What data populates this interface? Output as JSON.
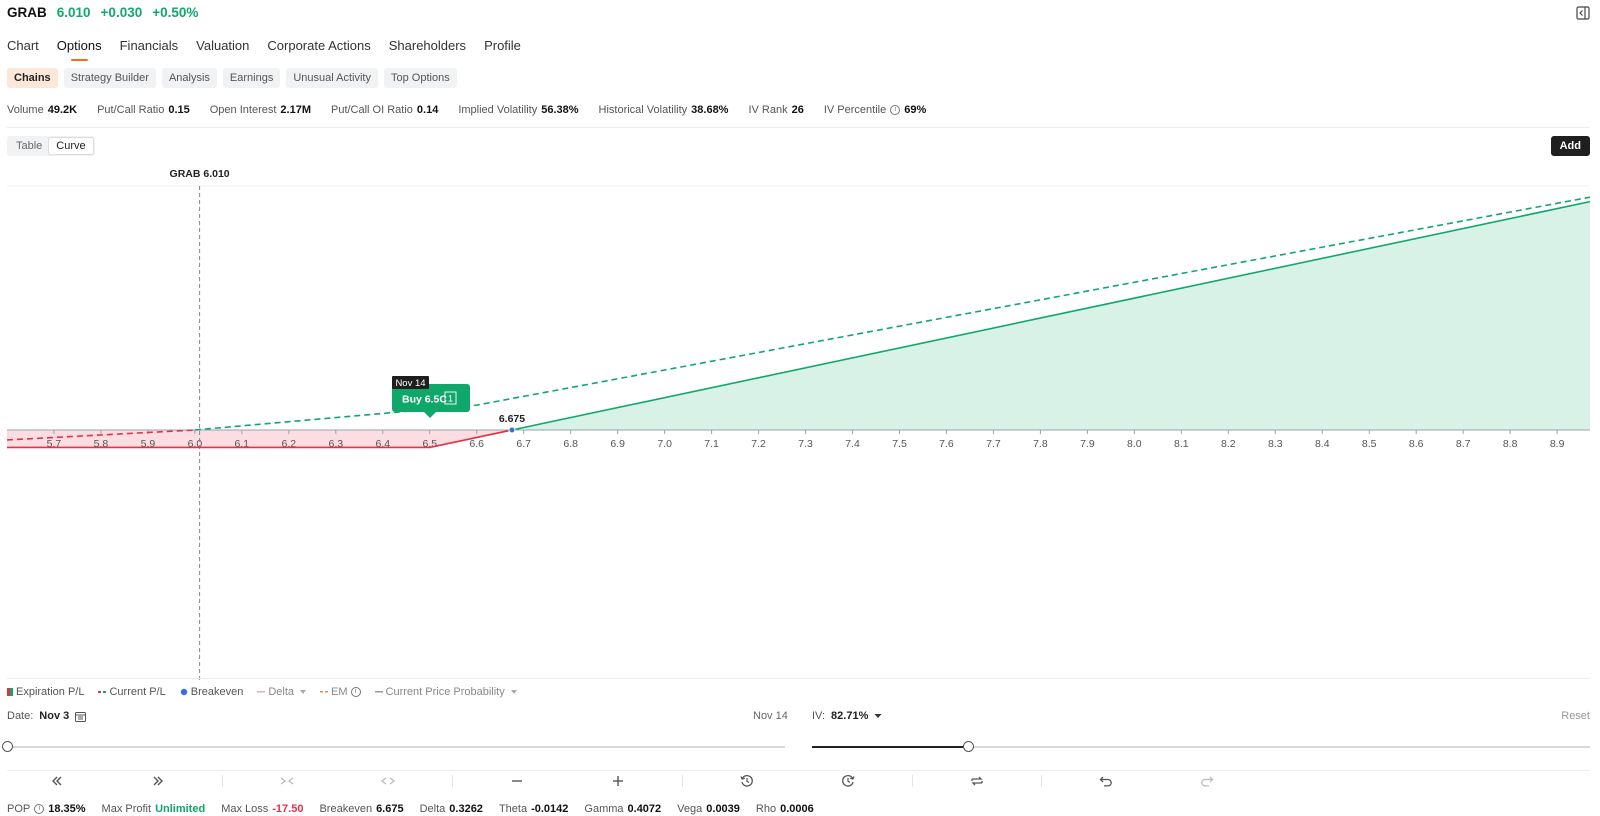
{
  "header": {
    "ticker": "GRAB",
    "price": "6.010",
    "change": "+0.030",
    "change_pct": "+0.50%"
  },
  "main_nav": [
    "Chart",
    "Options",
    "Financials",
    "Valuation",
    "Corporate Actions",
    "Shareholders",
    "Profile"
  ],
  "sub_nav": [
    "Chains",
    "Strategy Builder",
    "Analysis",
    "Earnings",
    "Unusual Activity",
    "Top Options"
  ],
  "stats": [
    {
      "label": "Volume",
      "value": "49.2K"
    },
    {
      "label": "Put/Call Ratio",
      "value": "0.15"
    },
    {
      "label": "Open Interest",
      "value": "2.17M"
    },
    {
      "label": "Put/Call OI Ratio",
      "value": "0.14"
    },
    {
      "label": "Implied Volatility",
      "value": "56.38%"
    },
    {
      "label": "Historical Volatility",
      "value": "38.68%"
    },
    {
      "label": "IV Rank",
      "value": "26"
    },
    {
      "label": "IV Percentile",
      "value": "69%"
    }
  ],
  "view_toggle": [
    "Table",
    "Curve"
  ],
  "add_label": "Add",
  "colors": {
    "profit": "#10a86a",
    "loss": "#e0334a",
    "breakeven": "#3a6de0",
    "accent": "#ff6a1a"
  },
  "chart_data": {
    "type": "line",
    "price_marker": {
      "label": "GRAB 6.010",
      "x": 6.01
    },
    "breakeven": {
      "label": "6.675",
      "x": 6.675
    },
    "tooltip": {
      "date": "Nov 14",
      "label": "Buy 6.5C",
      "qty": "1"
    },
    "x_ticks": [
      "5.7",
      "5.8",
      "5.9",
      "6.0",
      "6.1",
      "6.2",
      "6.3",
      "6.4",
      "6.5",
      "6.6",
      "6.7",
      "6.8",
      "6.9",
      "7.0",
      "7.1",
      "7.2",
      "7.3",
      "7.4",
      "7.5",
      "7.6",
      "7.7",
      "7.8",
      "7.9",
      "8.0",
      "8.1",
      "8.2",
      "8.3",
      "8.4",
      "8.5",
      "8.6",
      "8.7",
      "8.8",
      "8.9"
    ],
    "xlim": [
      5.6,
      8.97
    ],
    "series": [
      {
        "name": "Expiration P/L",
        "x": [
          5.6,
          6.5,
          6.675,
          8.97
        ],
        "y": [
          -17.5,
          -17.5,
          0,
          229.5
        ]
      },
      {
        "name": "Current P/L",
        "x": [
          5.6,
          6.0,
          6.6,
          8.97
        ],
        "y": [
          -10.0,
          0,
          25.0,
          234.0
        ]
      }
    ]
  },
  "legend": [
    {
      "label": "Expiration P/L",
      "on": true
    },
    {
      "label": "Current P/L",
      "on": true
    },
    {
      "label": "Breakeven",
      "on": true
    },
    {
      "label": "Delta",
      "on": false
    },
    {
      "label": "EM",
      "on": false
    },
    {
      "label": "Current Price Probability",
      "on": false
    }
  ],
  "date": {
    "label": "Date:",
    "value": "Nov 3",
    "expiry": "Nov 14",
    "position": 0
  },
  "iv": {
    "label": "IV:",
    "value": "82.71%",
    "reset": "Reset",
    "position": 0.2
  },
  "footer": [
    {
      "label": "POP",
      "value": "18.35%",
      "info": true,
      "cls": ""
    },
    {
      "label": "Max Profit",
      "value": "Unlimited",
      "cls": "green"
    },
    {
      "label": "Max Loss",
      "value": "-17.50",
      "cls": "red"
    },
    {
      "label": "Breakeven",
      "value": "6.675",
      "cls": ""
    },
    {
      "label": "Delta",
      "value": "0.3262",
      "cls": ""
    },
    {
      "label": "Theta",
      "value": "-0.0142",
      "cls": ""
    },
    {
      "label": "Gamma",
      "value": "0.4072",
      "cls": ""
    },
    {
      "label": "Vega",
      "value": "0.0039",
      "cls": ""
    },
    {
      "label": "Rho",
      "value": "0.0006",
      "cls": ""
    }
  ],
  "toolbar_icons": [
    "double-left-icon",
    "double-right-icon",
    "collapse-horizontal-icon",
    "expand-horizontal-icon",
    "minus-icon",
    "plus-icon",
    "history-icon",
    "clock-forward-icon",
    "swap-icon",
    "undo-icon",
    "redo-icon"
  ]
}
